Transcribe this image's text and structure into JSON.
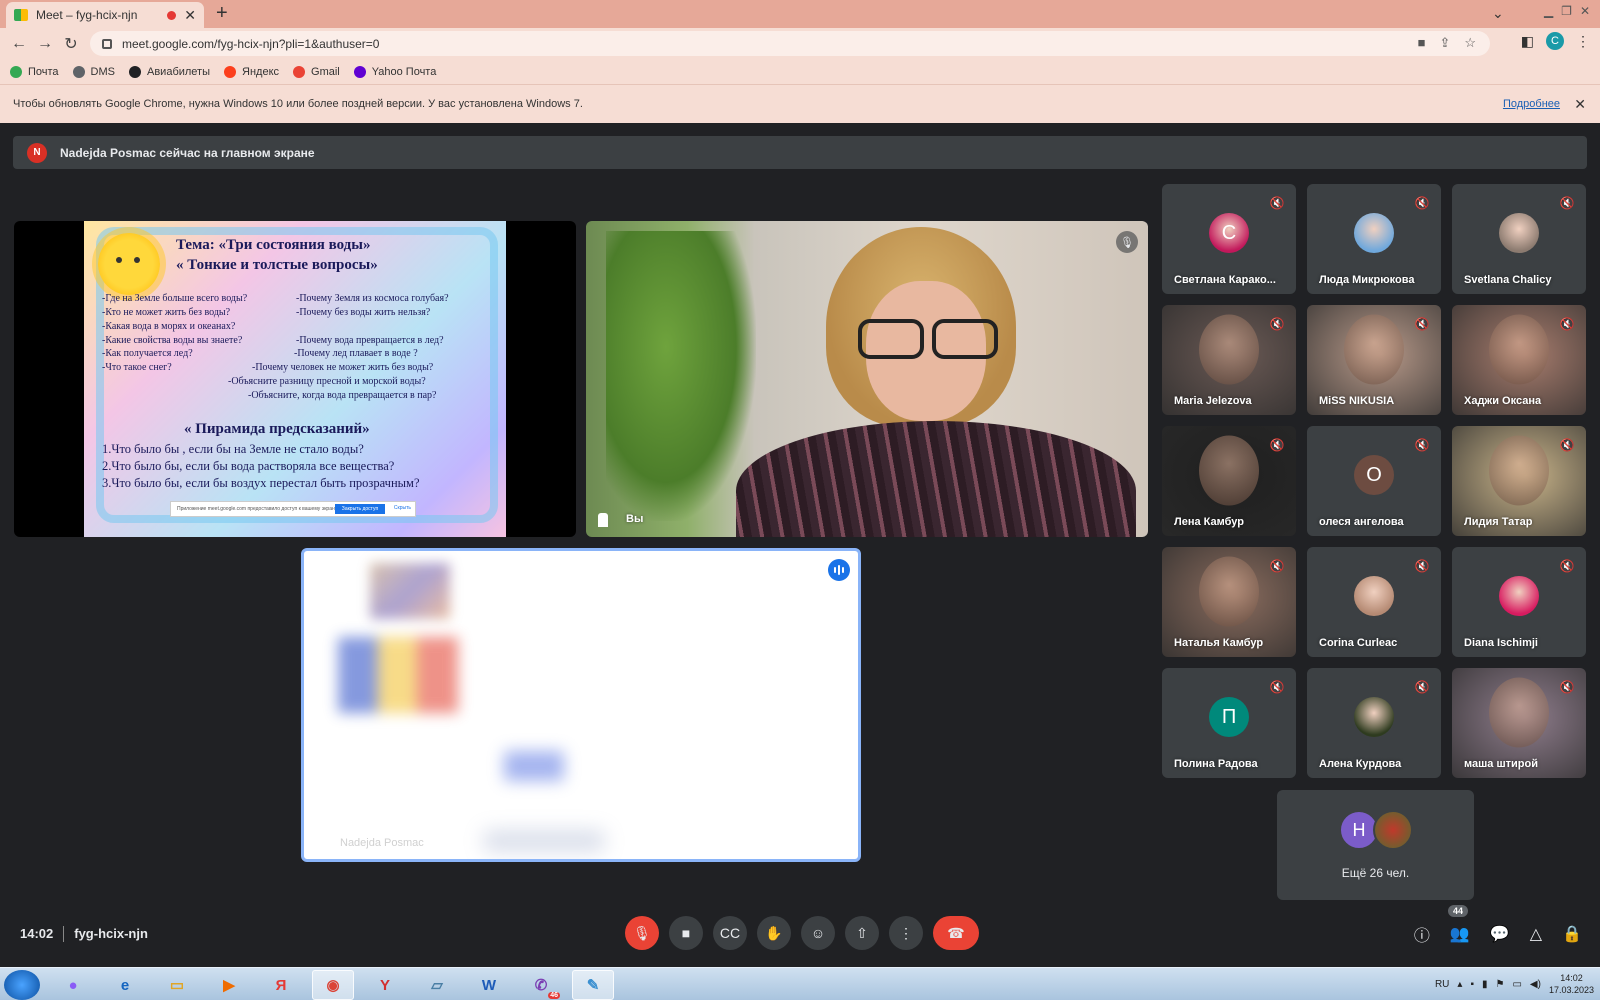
{
  "browser": {
    "tab_title": "Meet – fyg-hcix-njn",
    "new_tab": "+",
    "url": "meet.google.com/fyg-hcix-njn?pli=1&authuser=0",
    "profile_initial": "C",
    "bookmarks": [
      {
        "label": "Почта",
        "color": "#34a853"
      },
      {
        "label": "DMS",
        "color": "#5f6368"
      },
      {
        "label": "Авиабилеты",
        "color": "#202124"
      },
      {
        "label": "Яндекс",
        "color": "#fc3f1d"
      },
      {
        "label": "Gmail",
        "color": "#ea4335"
      },
      {
        "label": "Yahoo Почта",
        "color": "#6001d2"
      }
    ],
    "infobar": {
      "message": "Чтобы обновлять Google Chrome, нужна Windows 10 или более поздней версии. У вас установлена Windows 7.",
      "link": "Подробнее",
      "close": "✕"
    }
  },
  "meet": {
    "banner": {
      "initial": "N",
      "text": "Nadejda Posmac сейчас на главном экране"
    },
    "slide": {
      "title1": "Тема:   «Три состояния воды»",
      "title2": "« Тонкие и толстые вопросы»",
      "questions": [
        "-Где на Земле больше всего воды?",
        "-Кто не может жить без воды?",
        "-Какая вода в морях и океанах?",
        "-Какие свойства воды вы знаете?",
        "-Как получается лед?",
        "-Что такое снег?",
        "-Почему Земля из космоса голубая?",
        "-Почему без воды жить нельзя?",
        "-Почему вода превращается в лед?",
        "-Почему лед плавает в воде ?",
        "-Почему человек не может  жить без воды?",
        "-Объясните разницу пресной и   морской воды?",
        "-Объясните, когда вода превращается в пар?"
      ],
      "pyramid_title": "« Пирамида предсказаний»",
      "pyramid": [
        "1.Что было бы , если бы на Земле не стало воды?",
        "2.Что было бы, если бы вода растворяла все вещества?",
        "3.Что было бы, если бы воздух перестал быть прозрачным?"
      ],
      "share_text": "Приложение meet.google.com предоставило доступ к вашему экрану",
      "share_button": "Закрыть доступ",
      "share_hide": "Скрыть"
    },
    "self_name": "Вы",
    "presenter_name": "Nadejda Posmac",
    "participants": [
      {
        "name": "Светлана Каракo...",
        "type": "avatar",
        "color": "#c2185b",
        "initial": "C"
      },
      {
        "name": "Люда Микрюкова",
        "type": "avatar",
        "color": "#6fa8dc"
      },
      {
        "name": "Svetlana Chalicy",
        "type": "avatar",
        "color": "#8c7b70"
      },
      {
        "name": "Maria Jelezova",
        "type": "video",
        "color": "#6b5a55"
      },
      {
        "name": "MiSS NIKUSIA",
        "type": "video",
        "color": "#b89a8a"
      },
      {
        "name": "Хаджи Оксана",
        "type": "video",
        "color": "#a87d6e"
      },
      {
        "name": "Лена Камбур",
        "type": "video",
        "color": "#1f1f1f"
      },
      {
        "name": "олеся ангелова",
        "type": "letter",
        "color": "#6d4c41",
        "initial": "О"
      },
      {
        "name": "Лидия Татар",
        "type": "video",
        "color": "#c9b48a"
      },
      {
        "name": "Наталья Камбур",
        "type": "video",
        "color": "#8a6c5e"
      },
      {
        "name": "Corina Curleac",
        "type": "avatar",
        "color": "#b58a73"
      },
      {
        "name": "Diana Ischimji",
        "type": "avatar",
        "color": "#d81b60"
      },
      {
        "name": "Полина Радова",
        "type": "letter",
        "color": "#00897b",
        "initial": "П"
      },
      {
        "name": "Алена Курдова",
        "type": "avatar",
        "color": "#2e3b1f"
      },
      {
        "name": "маша штирой",
        "type": "video",
        "color": "#8f7d8c"
      }
    ],
    "more": {
      "initial": "Н",
      "text": "Ещё 26 чел."
    },
    "time": "14:02",
    "meeting_code": "fyg-hcix-njn",
    "people_count": "44"
  },
  "taskbar": {
    "lang": "RU",
    "time": "14:02",
    "date": "17.03.2023",
    "viber_count": "46"
  }
}
